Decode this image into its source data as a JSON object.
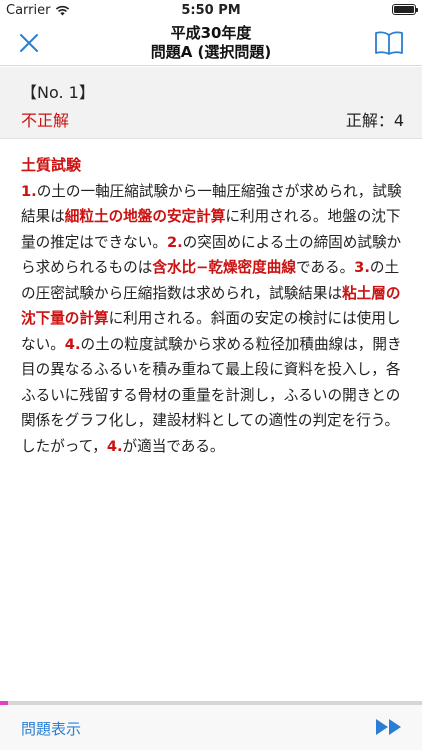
{
  "status": {
    "carrier": "Carrier",
    "time": "5:50 PM"
  },
  "nav": {
    "title_line1": "平成30年度",
    "title_line2": "問題A (選択問題)"
  },
  "question": {
    "number": "【No. 1】",
    "result": "不正解",
    "answer": "正解：4"
  },
  "explanation": {
    "heading": "土質試験",
    "segments": [
      {
        "t": "1.",
        "c": "num"
      },
      {
        "t": "の土の一軸圧縮試験から一軸圧縮強さが求められ，試験結果は",
        "c": ""
      },
      {
        "t": "細粒土の地盤の安定計算",
        "c": "hl"
      },
      {
        "t": "に利用される。地盤の沈下量の推定はできない。",
        "c": ""
      },
      {
        "t": "2.",
        "c": "num"
      },
      {
        "t": "の突固めによる土の締固め試験から求められるものは",
        "c": ""
      },
      {
        "t": "含水比−乾燥密度曲線",
        "c": "hl"
      },
      {
        "t": "である。",
        "c": ""
      },
      {
        "t": "3.",
        "c": "num"
      },
      {
        "t": "の土の圧密試験から圧縮指数は求められ，試験結果は",
        "c": ""
      },
      {
        "t": "粘土層の沈下量の計算",
        "c": "hl"
      },
      {
        "t": "に利用される。斜面の安定の検討には使用しない。",
        "c": ""
      },
      {
        "t": "4.",
        "c": "num"
      },
      {
        "t": "の土の粒度試験から求める粒径加積曲線は，開き目の異なるふるいを積み重ねて最上段に資料を投入し，各ふるいに残留する骨材の重量を計測し，ふるいの開きとの関係をグラフ化し，建設材料としての適性の判定を行う。したがって，",
        "c": ""
      },
      {
        "t": "4.",
        "c": "num"
      },
      {
        "t": "が適当である。",
        "c": ""
      }
    ]
  },
  "progress": {
    "fraction": 0.02,
    "color": "#e040c8"
  },
  "bottom": {
    "show_question_label": "問題表示"
  },
  "colors": {
    "accent": "#2a7fd4",
    "wrong": "#cc1111"
  },
  "icons": {
    "close": "close-icon",
    "book": "book-icon",
    "next": "fast-forward-icon",
    "wifi": "wifi-icon",
    "battery": "battery-icon"
  }
}
